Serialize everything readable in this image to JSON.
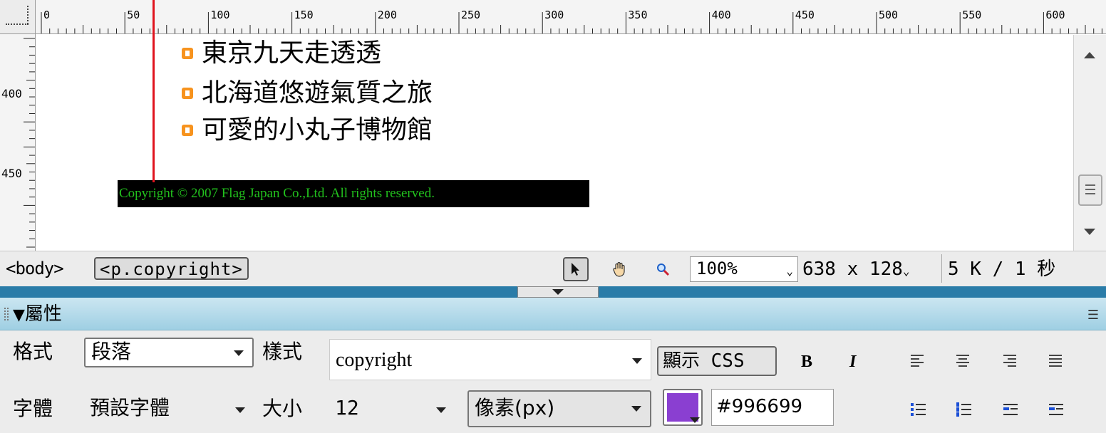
{
  "ruler": {
    "horizontal_labels": [
      "0",
      "50",
      "100",
      "150",
      "200",
      "250",
      "300",
      "350",
      "400",
      "450",
      "500",
      "550",
      "600"
    ],
    "vertical_labels": [
      "400",
      "450"
    ]
  },
  "document": {
    "list_items": [
      "東京九天走透透",
      "北海道悠遊氣質之旅",
      "可愛的小丸子博物館"
    ],
    "copyright_text": "Copyright © 2007 Flag Japan Co.,Ltd. All rights reserved."
  },
  "statusbar": {
    "tag_body": "<body>",
    "tag_selected": "<p.copyright>",
    "zoom": "100%",
    "window_size": "638 x 128",
    "download_stats": "5 K / 1 秒"
  },
  "properties_panel": {
    "title": "屬性",
    "format_label": "格式",
    "format_value": "段落",
    "style_label": "樣式",
    "style_value": "copyright",
    "show_css_label": "顯示 CSS",
    "bold_label": "B",
    "italic_label": "I",
    "font_label": "字體",
    "font_value": "預設字體",
    "size_label": "大小",
    "size_value": "12",
    "unit_value": "像素(px)",
    "color_value": "#996699",
    "swatch_color": "#8a3fd1"
  },
  "colors": {
    "accent_bar": "#2a7ca8",
    "copyright_text": "#22c21d",
    "guide_line": "#e0141e",
    "bullet": "#f7931e"
  }
}
